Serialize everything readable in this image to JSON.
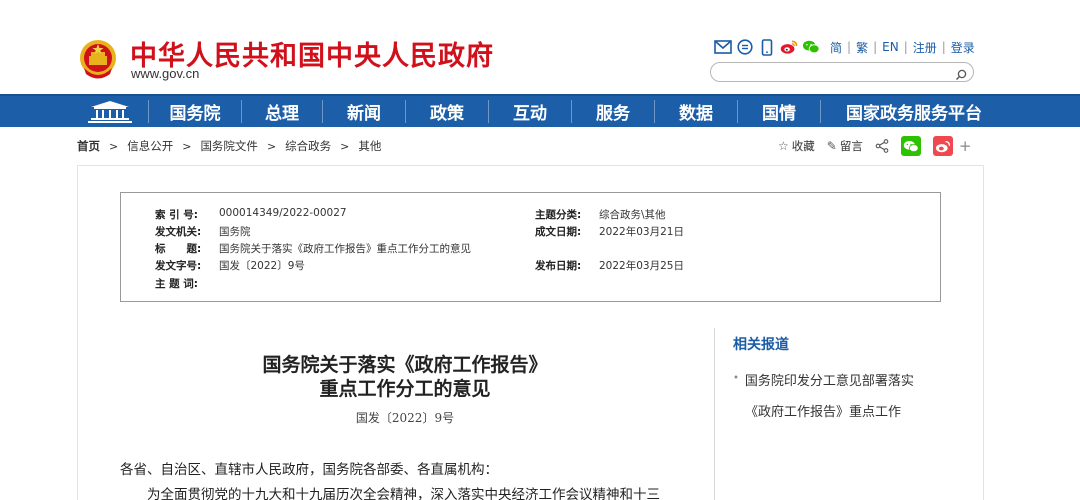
{
  "header": {
    "title": "中华人民共和国中央人民政府",
    "domain": "www.gov.cn",
    "tools": [
      "mail-icon",
      "message-icon",
      "mobile-icon",
      "weibo-icon",
      "wechat-icon"
    ],
    "links": [
      "简",
      "繁",
      "EN",
      "注册",
      "登录"
    ],
    "search": {
      "placeholder": "",
      "value": ""
    }
  },
  "nav": {
    "items": [
      "国务院",
      "总理",
      "新闻",
      "政策",
      "互动",
      "服务",
      "数据",
      "国情",
      "国家政务服务平台"
    ]
  },
  "breadcrumb": [
    "首页",
    "信息公开",
    "国务院文件",
    "综合政务",
    "其他"
  ],
  "share": {
    "collect": "收藏",
    "comment": "留言"
  },
  "meta": {
    "index_label": "索 引 号:",
    "index_value": "000014349/2022-00027",
    "issuer_label": "发文机关:",
    "issuer_value": "国务院",
    "title_label": "标　　题:",
    "title_value": "国务院关于落实《政府工作报告》重点工作分工的意见",
    "docno_label": "发文字号:",
    "docno_value": "国发〔2022〕9号",
    "keywords_label": "主 题 词:",
    "keywords_value": "",
    "category_label": "主题分类:",
    "category_value": "综合政务\\其他",
    "written_label": "成文日期:",
    "written_value": "2022年03月21日",
    "published_label": "发布日期:",
    "published_value": "2022年03月25日"
  },
  "article": {
    "title_line1": "国务院关于落实《政府工作报告》",
    "title_line2": "重点工作分工的意见",
    "doc_number": "国发〔2022〕9号",
    "para1": "各省、自治区、直辖市人民政府，国务院各部委、各直属机构：",
    "para2": "　　为全面贯彻党的十九大和十九届历次全会精神，深入落实中央经济工作会议精神和十三"
  },
  "sidebar": {
    "title": "相关报道",
    "item_line1": "国务院印发分工意见部署落实",
    "item_line2": "《政府工作报告》重点工作"
  },
  "colors": {
    "brand_red": "#d0101b",
    "nav_blue": "#1c5fa8",
    "link_blue": "#1a5ca7",
    "wechat_green": "#2dc100",
    "weibo_red": "#e6162d"
  }
}
